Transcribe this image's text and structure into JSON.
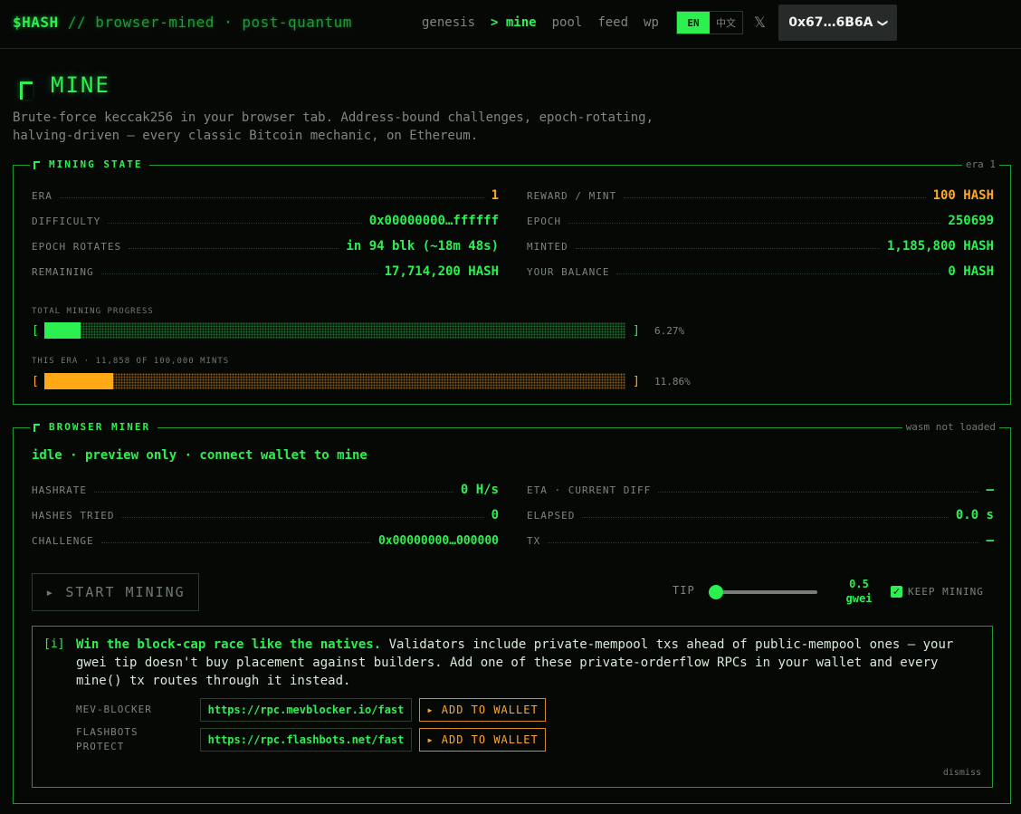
{
  "header": {
    "brand": "$HASH",
    "tagline": "// browser-mined · post-quantum",
    "nav": [
      {
        "label": "genesis"
      },
      {
        "label": "> mine"
      },
      {
        "label": "pool"
      },
      {
        "label": "feed"
      },
      {
        "label": "wp"
      }
    ],
    "lang_en": "EN",
    "lang_zh": "中文",
    "x_icon": "𝕏",
    "wallet": "0x67…6B6A",
    "wallet_chevron": "❯"
  },
  "page": {
    "title": "MINE",
    "subtitle": "Brute-force keccak256 in your browser tab. Address-bound challenges, epoch-rotating, halving-driven — every classic Bitcoin mechanic, on Ethereum."
  },
  "mining_state": {
    "title": "MINING STATE",
    "tag": "era 1",
    "left": [
      {
        "key": "ERA",
        "value": "1",
        "color": "#ffa62b"
      },
      {
        "key": "DIFFICULTY",
        "value": "0x00000000…ffffff",
        "color": "#2cf04f"
      },
      {
        "key": "EPOCH ROTATES",
        "value": "in 94 blk (~18m 48s)",
        "color": "#2cf04f"
      },
      {
        "key": "REMAINING",
        "value": "17,714,200 HASH",
        "color": "#2cf04f"
      }
    ],
    "right": [
      {
        "key": "REWARD / MINT",
        "value": "100 HASH",
        "color": "#ffa62b"
      },
      {
        "key": "EPOCH",
        "value": "250699",
        "color": "#2cf04f"
      },
      {
        "key": "MINTED",
        "value": "1,185,800 HASH",
        "color": "#2cf04f"
      },
      {
        "key": "YOUR BALANCE",
        "value": "0 HASH",
        "color": "#2cf04f"
      }
    ],
    "total_progress_label": "TOTAL MINING PROGRESS",
    "total_progress": 0.0627,
    "total_progress_text": "6.27%",
    "era_progress_label": "THIS ERA · 11,858 OF 100,000 MINTS",
    "era_progress": 0.1186,
    "era_progress_text": "11.86%",
    "bracket_open": "[",
    "bracket_close": "]"
  },
  "browser_miner": {
    "title": "BROWSER MINER",
    "tag": "wasm not loaded",
    "status": "idle · preview only · connect wallet to mine",
    "left": [
      {
        "key": "HASHRATE",
        "value": "0 H/s"
      },
      {
        "key": "HASHES TRIED",
        "value": "0"
      },
      {
        "key": "CHALLENGE",
        "value": "0x00000000…000000"
      }
    ],
    "right": [
      {
        "key": "ETA · CURRENT DIFF",
        "value": "—"
      },
      {
        "key": "ELAPSED",
        "value": "0.0 s"
      },
      {
        "key": "TX",
        "value": "—"
      }
    ],
    "start_button": "▸ START MINING",
    "tip_label": "TIP",
    "tip_value": "0.5",
    "tip_unit": "gwei",
    "tip_slider_level": 0.0,
    "keep_mining_label": "KEEP MINING",
    "keep_mining_checked": "✓",
    "info": {
      "mark": "[i]",
      "headline": "Win the block-cap race like the natives.",
      "body": " Validators include private-mempool txs ahead of public-mempool ones — your gwei tip doesn't buy placement against builders. Add one of these private-orderflow RPCs in your wallet and every mine() tx routes through it instead.",
      "rpcs": [
        {
          "name": "MEV-BLOCKER",
          "url": "https://rpc.mevblocker.io/fast",
          "button": "▸ ADD TO WALLET"
        },
        {
          "name": "FLASHBOTS PROTECT",
          "url": "https://rpc.flashbots.net/fast",
          "button": "▸ ADD TO WALLET"
        }
      ],
      "dismiss": "dismiss"
    }
  },
  "colors": {
    "accent": "#2cf04f",
    "orange": "#ffa62b",
    "background": "#060806"
  }
}
